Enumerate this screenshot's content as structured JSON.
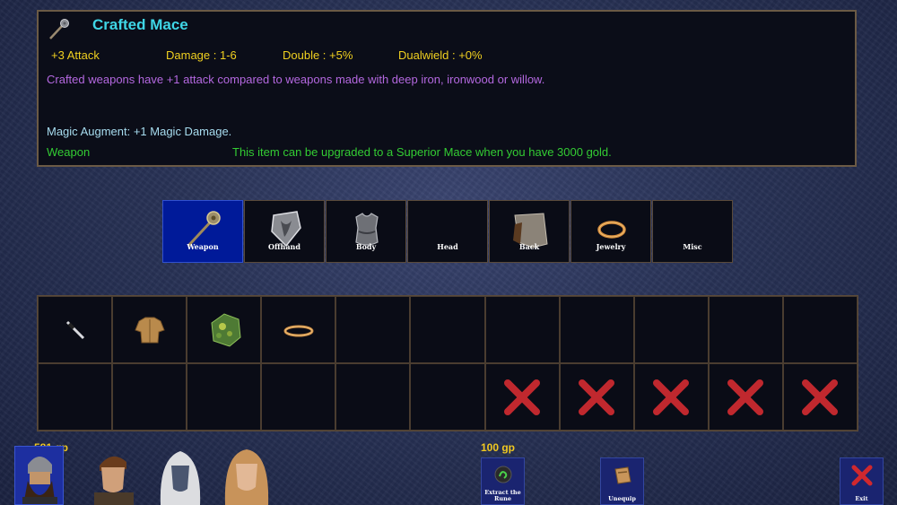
{
  "item": {
    "name": "Crafted Mace",
    "stats": {
      "attack": "+3 Attack",
      "damage": "Damage : 1-6",
      "double": "Double : +5%",
      "dualwield": "Dualwield : +0%"
    },
    "description": "Crafted weapons have +1 attack compared to weapons made with deep iron, ironwood or willow.",
    "augment": "Magic Augment: +1 Magic Damage.",
    "type": "Weapon",
    "upgrade_note": "This item can be upgraded to a Superior Mace when you have 3000 gold.",
    "icon": "mace-icon"
  },
  "tabs": [
    {
      "label": "Weapon",
      "icon": "mace-icon",
      "active": true
    },
    {
      "label": "Offhand",
      "icon": "shield-icon"
    },
    {
      "label": "Body",
      "icon": "chest-armor-icon"
    },
    {
      "label": "Head",
      "icon": ""
    },
    {
      "label": "Back",
      "icon": "cloak-icon"
    },
    {
      "label": "Jewelry",
      "icon": "ring-icon"
    },
    {
      "label": "Misc",
      "icon": ""
    }
  ],
  "inventory": {
    "row1": [
      "dagger-icon",
      "tunic-icon",
      "herb-bundle-icon",
      "ring-icon",
      "",
      "",
      "",
      "",
      "",
      "",
      ""
    ],
    "row2": [
      "",
      "",
      "",
      "",
      "",
      "",
      "locked-x-icon",
      "locked-x-icon",
      "locked-x-icon",
      "locked-x-icon",
      "locked-x-icon"
    ]
  },
  "gold_party": "581 gp",
  "gold_cost": "100 gp",
  "portraits": [
    "dwarf-warrior-portrait",
    "young-man-portrait",
    "dark-elf-portrait",
    "blonde-woman-portrait"
  ],
  "buttons": {
    "extract": "Extract the Rune",
    "unequip": "Unequip",
    "exit": "Exit"
  },
  "colors": {
    "name": "#3fd6e6",
    "stats": "#f0d020",
    "description": "#b468e0",
    "weapon_type": "#33cc33",
    "active_tab": "#001a99",
    "locked_x": "#c0282e"
  }
}
